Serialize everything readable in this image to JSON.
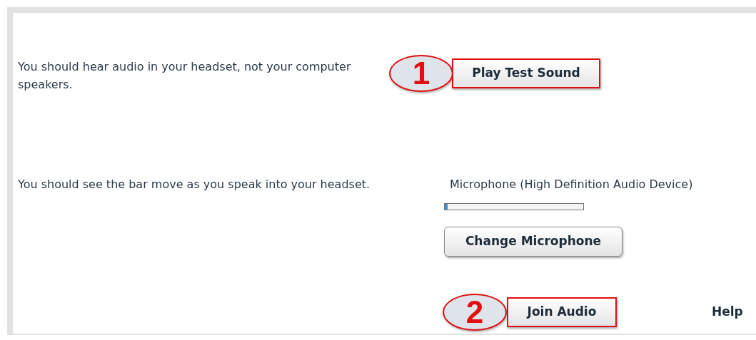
{
  "speaker_test": {
    "instruction": "You should hear audio in your headset, not your computer speakers.",
    "step": "1",
    "button": "Play Test Sound"
  },
  "microphone_test": {
    "instruction": "You should see the bar move as you speak into your headset.",
    "device": "Microphone (High Definition Audio Device)",
    "level": 0.02,
    "button": "Change Microphone"
  },
  "join": {
    "step": "2",
    "button": "Join Audio",
    "help_link": "Help"
  }
}
